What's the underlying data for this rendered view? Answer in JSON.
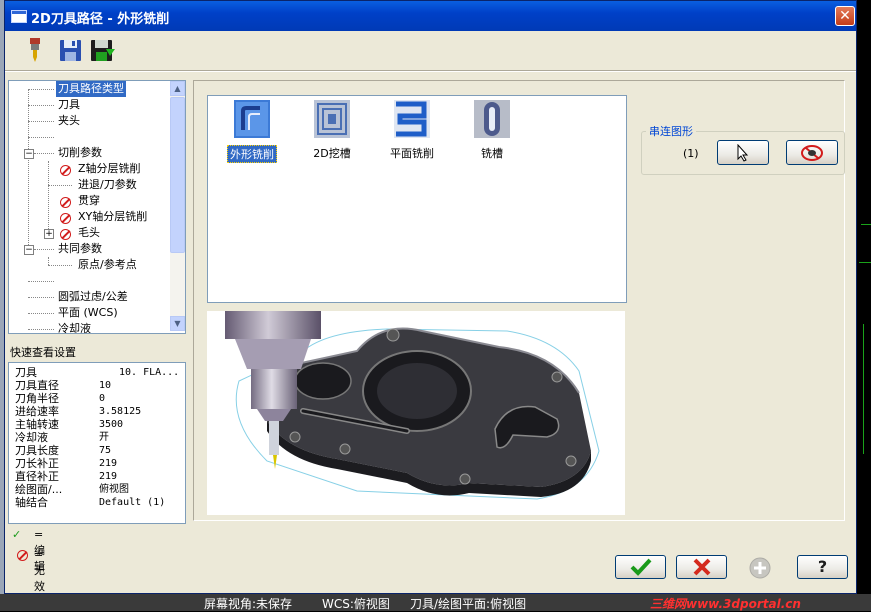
{
  "window": {
    "title": "2D刀具路径 - 外形铣削"
  },
  "toolbar": {
    "icons": [
      "tool-icon",
      "save-icon",
      "save-as-icon"
    ]
  },
  "tree": {
    "items": [
      {
        "label": "刀具路径类型",
        "selected": true
      },
      {
        "label": "刀具"
      },
      {
        "label": "夹头"
      },
      {
        "label": ""
      },
      {
        "label": "切削参数"
      },
      {
        "label": "Z轴分层铣削",
        "disabled": true
      },
      {
        "label": "进退/刀参数"
      },
      {
        "label": "贯穿",
        "disabled": true
      },
      {
        "label": "XY轴分层铣削",
        "disabled": true
      },
      {
        "label": "毛头",
        "disabled": true
      },
      {
        "label": "共同参数"
      },
      {
        "label": "原点/参考点"
      },
      {
        "label": ""
      },
      {
        "label": "圆弧过虑/公差"
      },
      {
        "label": "平面 (WCS)"
      },
      {
        "label": "冷却液"
      }
    ]
  },
  "quick": {
    "title": "快速查看设置",
    "rows": [
      {
        "k": "刀具",
        "v": "10. FLA..."
      },
      {
        "k": "刀具直径",
        "v": "10"
      },
      {
        "k": "刀角半径",
        "v": "0"
      },
      {
        "k": "进给速率",
        "v": "3.58125"
      },
      {
        "k": "主轴转速",
        "v": "3500"
      },
      {
        "k": "冷却液",
        "v": "开"
      },
      {
        "k": "刀具长度",
        "v": "75"
      },
      {
        "k": "刀长补正",
        "v": "219"
      },
      {
        "k": "直径补正",
        "v": "219"
      },
      {
        "k": "绘图面/...",
        "v": "俯视图"
      },
      {
        "k": "轴结合",
        "v": "Default (1)"
      }
    ]
  },
  "legend": {
    "edit": "=编辑",
    "invalid": "=无效"
  },
  "types": [
    {
      "label": "外形铣削",
      "selected": true
    },
    {
      "label": "2D挖槽"
    },
    {
      "label": "平面铣削"
    },
    {
      "label": "铣槽"
    }
  ],
  "chain": {
    "title": "串连图形",
    "count": "(1)"
  },
  "colors": {
    "accent": "#316ac5",
    "ok": "#1a9a1a",
    "cancel": "#d42a1e"
  },
  "status": {
    "view": "屏幕视角:未保存",
    "wcs": "WCS:俯视图",
    "plane": "刀具/绘图平面:俯视图",
    "watermark": "三维网www.3dportal.cn"
  }
}
